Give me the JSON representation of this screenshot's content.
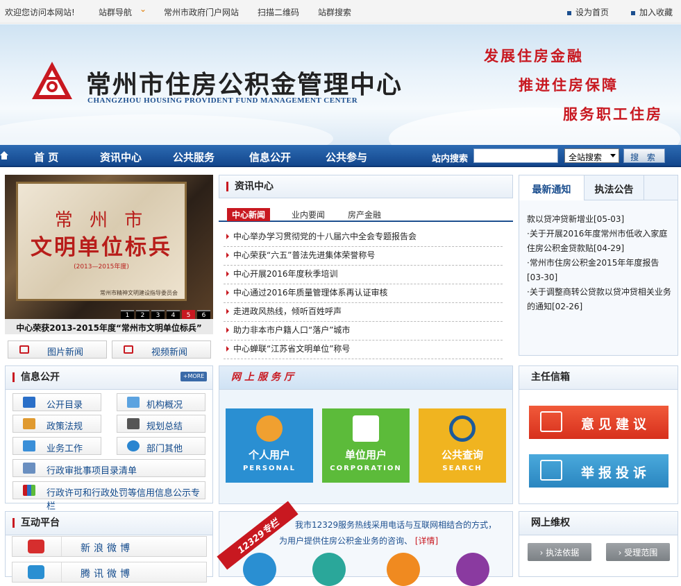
{
  "topbar": {
    "welcome": "欢迎您访问本网站!",
    "site_nav": "站群导航",
    "gov_portal": "常州市政府门户网站",
    "qr": "扫描二维码",
    "site_search": "站群搜索",
    "set_home": "设为首页",
    "bookmark": "加入收藏"
  },
  "banner": {
    "title": "常州市住房公积金管理中心",
    "subtitle": "CHANGZHOU HOUSING PROVIDENT FUND MANAGEMENT CENTER",
    "slogans": [
      "发展住房金融",
      "推进住房保障",
      "服务职工住房"
    ]
  },
  "nav": {
    "items": [
      "首 页",
      "资讯中心",
      "公共服务",
      "信息公开",
      "公共参与"
    ],
    "search_label": "站内搜索",
    "search_value": "",
    "scope": "全站搜索",
    "search_button": "搜 索"
  },
  "slideshow": {
    "plaque_line1": "常 州 市",
    "plaque_line2": "文明单位标兵",
    "plaque_line3": "(2013—2015年度)",
    "plaque_issuer": "常州市精神文明建设指导委员会",
    "pages": [
      "1",
      "2",
      "3",
      "4",
      "5",
      "6"
    ],
    "active_page": "5",
    "caption": "中心荣获2013-2015年度“常州市文明单位标兵”",
    "photo_news": "图片新闻",
    "video_news": "视频新闻"
  },
  "news_center": {
    "title": "资讯中心",
    "tabs": [
      "中心新闻",
      "业内要闻",
      "房产金融"
    ],
    "items": [
      "中心举办学习贯彻党的十八届六中全会专题报告会",
      "中心荣获“六五”普法先进集体荣誉称号",
      "中心开展2016年度秋季培训",
      "中心通过2016年质量管理体系再认证审核",
      "走进政风热线，倾听百姓呼声",
      "助力非本市户籍人口“落户”城市",
      "中心蝉联“江苏省文明单位”称号"
    ]
  },
  "notices": {
    "tabs": [
      "最新通知",
      "执法公告"
    ],
    "items": [
      "款以贷冲贷新增业[05-03]",
      "·关于开展2016年度常州市低收入家庭住房公积金贷款贴[04-29]",
      "·常州市住房公积金2015年年度报告[03-30]",
      "·关于调整商转公贷款以贷冲贷相关业务的通知[02-26]"
    ]
  },
  "info_public": {
    "title": "信息公开",
    "more": "+MORE",
    "items": [
      "公开目录",
      "机构概况",
      "政策法规",
      "规划总结",
      "业务工作",
      "部门其他"
    ],
    "wide": [
      "行政审批事项目录清单",
      "行政许可和行政处罚等信用信息公示专栏"
    ]
  },
  "online_hall": {
    "title": "网上服务厅",
    "services": [
      {
        "name": "个人用户",
        "en": "PERSONAL",
        "color": "#2a8fd2"
      },
      {
        "name": "单位用户",
        "en": "CORPORATION",
        "color": "#5cbb3a"
      },
      {
        "name": "公共查询",
        "en": "SEARCH",
        "color": "#f0b420"
      }
    ]
  },
  "director_mail": {
    "title": "主任信箱",
    "suggest": "意见建议",
    "report": "举报投诉"
  },
  "interaction": {
    "title": "互动平台",
    "weibo1": "新浪微博",
    "weibo2": "腾讯微博"
  },
  "hotline": {
    "badge": "12329专栏",
    "text1": "我市12329服务热线采用电话与互联网相结合的方式，",
    "text2": "为用户提供住房公积金业务的咨询、",
    "detail": "[详情]"
  },
  "rights": {
    "title": "网上维权",
    "basis": "执法依据",
    "scope": "受理范围"
  }
}
